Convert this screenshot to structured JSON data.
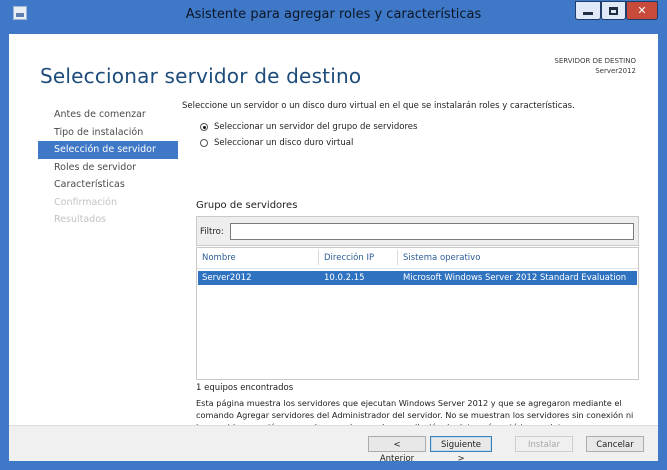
{
  "window": {
    "title": "Asistente para agregar roles y características",
    "controls": [
      "minimize-icon",
      "maximize-icon",
      "close-icon"
    ],
    "accent": "#3e78c6"
  },
  "header": {
    "page_title": "Seleccionar servidor de destino",
    "destination_label": "SERVIDOR DE DESTINO",
    "destination_value": "Server2012"
  },
  "steps": [
    {
      "label": "Antes de comenzar",
      "state": "normal"
    },
    {
      "label": "Tipo de instalación",
      "state": "normal"
    },
    {
      "label": "Selección de servidor",
      "state": "active"
    },
    {
      "label": "Roles de servidor",
      "state": "normal"
    },
    {
      "label": "Características",
      "state": "normal"
    },
    {
      "label": "Confirmación",
      "state": "disabled"
    },
    {
      "label": "Resultados",
      "state": "disabled"
    }
  ],
  "content": {
    "intro": "Seleccione un servidor o un disco duro virtual en el que se instalarán roles y características.",
    "options": [
      {
        "label": "Seleccionar un servidor del grupo de servidores",
        "checked": true
      },
      {
        "label": "Seleccionar un disco duro virtual",
        "checked": false
      }
    ],
    "group_title": "Grupo de servidores",
    "filter_label": "Filtro:",
    "filter_value": "",
    "table": {
      "columns": [
        "Nombre",
        "Dirección IP",
        "Sistema operativo"
      ],
      "rows": [
        {
          "name": "Server2012",
          "ip": "10.0.2.15",
          "os": "Microsoft Windows Server 2012 Standard Evaluation",
          "selected": true
        }
      ]
    },
    "count_text": "1 equipos encontrados",
    "note": "Esta página muestra los servidores que ejecutan Windows Server 2012 y que se agregaron mediante el comando Agregar servidores del Administrador del servidor. No se muestran los servidores sin conexión ni los servidores recién agregados para los que la recopilación de datos aún está incompleta."
  },
  "footer": {
    "back": "< Anterior",
    "next": "Siguiente >",
    "install": "Instalar",
    "cancel": "Cancelar"
  }
}
